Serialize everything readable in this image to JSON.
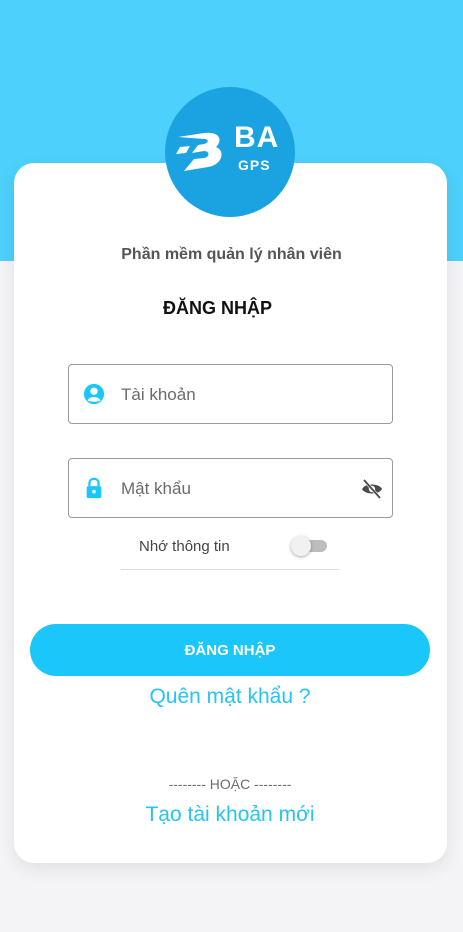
{
  "app": {
    "logo_text_top": "BA",
    "logo_text_bottom": "GPS",
    "brand_color": "#1aa3e0",
    "header_bg": "#4dd0fb",
    "accent": "#1bc6fb"
  },
  "login": {
    "subtitle": "Phần mềm quản lý nhân viên",
    "title": "ĐĂNG NHẬP",
    "username_placeholder": "Tài khoản",
    "username_icon": "person-circle-icon",
    "password_placeholder": "Mật khẩu",
    "password_icon": "lock-icon",
    "visibility_icon": "eye-off-icon",
    "remember_label": "Nhớ thông tin",
    "remember_on": false,
    "submit_label": "ĐĂNG NHẬP",
    "forgot_label": "Quên mật khẩu ?",
    "or_label": "-------- HOẶC --------",
    "create_label": "Tạo tài khoản mới"
  }
}
